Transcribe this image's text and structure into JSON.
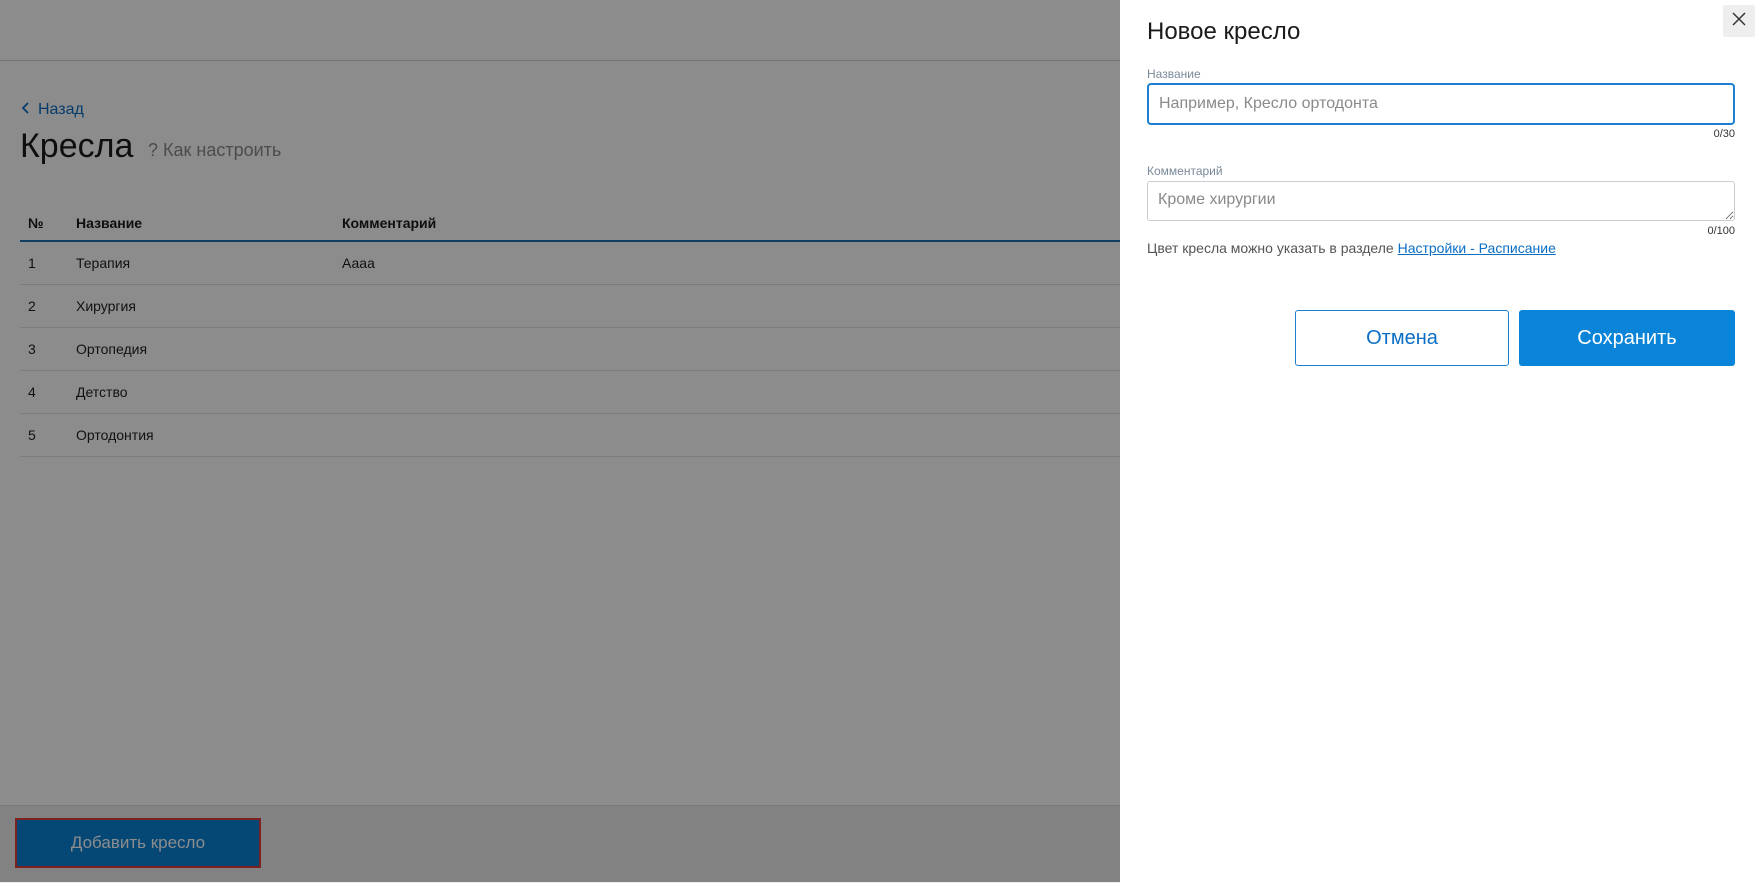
{
  "page": {
    "back_label": "Назад",
    "title": "Кресла",
    "help_label": "? Как настроить",
    "table": {
      "headers": [
        "№",
        "Название",
        "Комментарий"
      ],
      "rows": [
        {
          "num": "1",
          "name": "Терапия",
          "comment": "Аааа"
        },
        {
          "num": "2",
          "name": "Хирургия",
          "comment": ""
        },
        {
          "num": "3",
          "name": "Ортопедия",
          "comment": ""
        },
        {
          "num": "4",
          "name": "Детство",
          "comment": ""
        },
        {
          "num": "5",
          "name": "Ортодонтия",
          "comment": ""
        }
      ]
    },
    "add_button_label": "Добавить кресло"
  },
  "drawer": {
    "title": "Новое кресло",
    "name_field": {
      "label": "Название",
      "value": "",
      "placeholder": "Например, Кресло ортодонта",
      "counter": "0/30"
    },
    "comment_field": {
      "label": "Комментарий",
      "value": "",
      "placeholder": "Кроме хирургии",
      "counter": "0/100"
    },
    "hint_text": "Цвет кресла можно указать в разделе ",
    "hint_link": "Настройки - Расписание",
    "cancel_label": "Отмена",
    "save_label": "Сохранить"
  },
  "colors": {
    "accent": "#0a84d8",
    "link": "#0b6ec5",
    "highlight_border": "#e23b3b",
    "overlay": "rgba(0,0,0,0.45)"
  },
  "icons": {
    "back": "chevron-left-icon",
    "close": "close-icon",
    "resize": "resize-handle-icon"
  }
}
